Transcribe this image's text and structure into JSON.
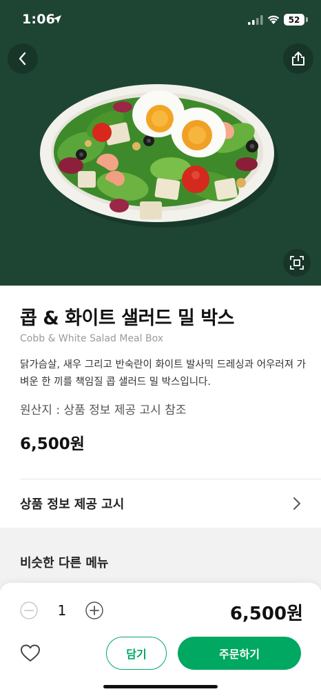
{
  "status_bar": {
    "time": "1:06",
    "battery": "52"
  },
  "hero": {
    "image": "cobb-salad-bowl",
    "icons": [
      "back-arrow-icon",
      "share-icon",
      "fullscreen-icon"
    ]
  },
  "product": {
    "title": "콥 & 화이트 샐러드 밀 박스",
    "subtitle": "Cobb & White Salad Meal Box",
    "description": "닭가슴살, 새우 그리고 반숙란이 화이트 발사믹 드레싱과 어우러져 가벼운 한 끼를 책임질 콥 샐러드 밀 박스입니다.",
    "origin": "원산지 : 상품 정보 제공 고시 참조",
    "price": "6,500원"
  },
  "notice": {
    "label": "상품 정보 제공 고시"
  },
  "similar": {
    "title": "비슷한 다른 메뉴"
  },
  "order_bar": {
    "quantity": "1",
    "total": "6,500원",
    "cart_label": "담기",
    "order_label": "주문하기"
  },
  "colors": {
    "hero_bg": "#1e4434",
    "accent": "#00a862"
  }
}
